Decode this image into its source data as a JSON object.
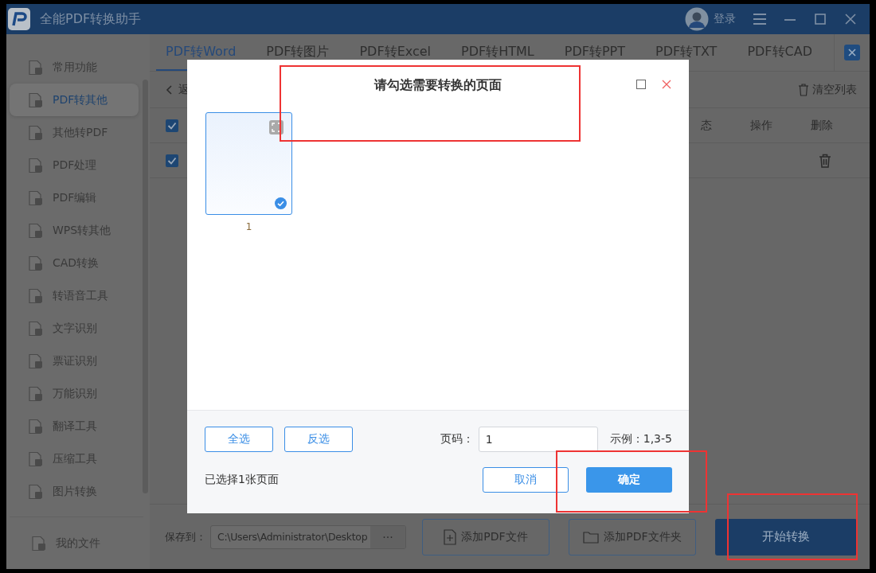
{
  "app": {
    "title": "全能PDF转换助手",
    "login": "登录"
  },
  "sidebar": {
    "items": [
      {
        "label": "常用功能",
        "selected": false
      },
      {
        "label": "PDF转其他",
        "selected": true
      },
      {
        "label": "其他转PDF",
        "selected": false
      },
      {
        "label": "PDF处理",
        "selected": false
      },
      {
        "label": "PDF编辑",
        "selected": false
      },
      {
        "label": "WPS转其他",
        "selected": false
      },
      {
        "label": "CAD转换",
        "selected": false
      },
      {
        "label": "转语音工具",
        "selected": false
      },
      {
        "label": "文字识别",
        "selected": false
      },
      {
        "label": "票证识别",
        "selected": false
      },
      {
        "label": "万能识别",
        "selected": false
      },
      {
        "label": "翻译工具",
        "selected": false
      },
      {
        "label": "压缩工具",
        "selected": false
      },
      {
        "label": "图片转换",
        "selected": false
      }
    ],
    "footer_item": "我的文件"
  },
  "tabs": [
    {
      "label": "PDF转Word",
      "selected": true
    },
    {
      "label": "PDF转图片",
      "selected": false
    },
    {
      "label": "PDF转Excel",
      "selected": false
    },
    {
      "label": "PDF转HTML",
      "selected": false
    },
    {
      "label": "PDF转PPT",
      "selected": false
    },
    {
      "label": "PDF转TXT",
      "selected": false
    },
    {
      "label": "PDF转CAD",
      "selected": false
    }
  ],
  "file_panel": {
    "back": "返",
    "clear": "清空列表",
    "columns": [
      "态",
      "操作",
      "删除"
    ],
    "header_checked": true,
    "rows": [
      {
        "checked": true
      }
    ]
  },
  "bottom_bar": {
    "save_label": "保存到：",
    "path": "C:\\Users\\Administrator\\Desktop",
    "browse": "···",
    "add_file": "添加PDF文件",
    "add_folder": "添加PDF文件夹",
    "start": "开始转换"
  },
  "dialog": {
    "title": "请勾选需要转换的页面",
    "pages": [
      {
        "number": "1",
        "selected": true
      }
    ],
    "select_all": "全选",
    "invert": "反选",
    "page_label": "页码：",
    "page_value": "1",
    "example": "示例：1,3-5",
    "selected_count": "已选择1张页面",
    "cancel": "取消",
    "confirm": "确定"
  }
}
